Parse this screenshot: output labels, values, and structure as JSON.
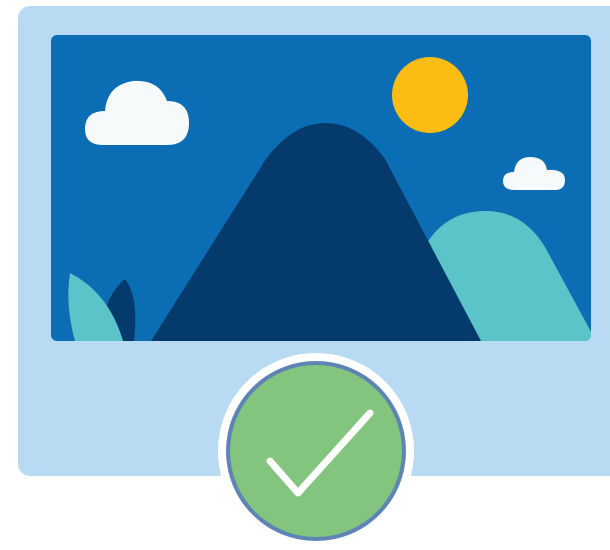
{
  "illustration": {
    "subject": "image-placeholder-icon",
    "icons": [
      "cloud-icon",
      "sun-icon",
      "mountain-icon",
      "leaf-icon",
      "checkmark-icon"
    ],
    "status": "approved"
  },
  "colors": {
    "frame": "#b8dbf3",
    "sky": "#0b6db4",
    "sun": "#fbbd14",
    "cloud": "#f7fafb",
    "mountain_dark": "#053a6c",
    "hill_teal": "#5bc4c8",
    "leaf_teal": "#5bc4c8",
    "leaf_dark": "#053a6c",
    "check_fill": "#83c57f",
    "check_ring": "#5d84b4",
    "check_border": "#ffffff",
    "check_mark": "#ffffff"
  }
}
